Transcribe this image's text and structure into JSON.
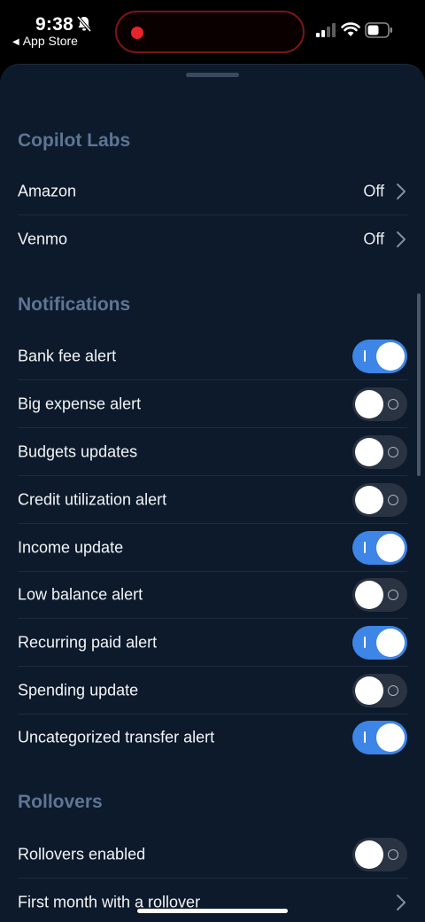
{
  "status_bar": {
    "time": "9:38",
    "back_app": "App Store",
    "icons": [
      "bell-slash-icon",
      "signal-icon",
      "wifi-icon",
      "battery-icon"
    ],
    "recording_color": "#e8232b"
  },
  "sections": {
    "copilot_labs": {
      "title": "Copilot Labs",
      "items": [
        {
          "label": "Amazon",
          "value": "Off"
        },
        {
          "label": "Venmo",
          "value": "Off"
        }
      ]
    },
    "notifications": {
      "title": "Notifications",
      "items": [
        {
          "label": "Bank fee alert",
          "enabled": true
        },
        {
          "label": "Big expense alert",
          "enabled": false
        },
        {
          "label": "Budgets updates",
          "enabled": false
        },
        {
          "label": "Credit utilization alert",
          "enabled": false
        },
        {
          "label": "Income update",
          "enabled": true
        },
        {
          "label": "Low balance alert",
          "enabled": false
        },
        {
          "label": "Recurring paid alert",
          "enabled": true
        },
        {
          "label": "Spending update",
          "enabled": false
        },
        {
          "label": "Uncategorized transfer alert",
          "enabled": true
        }
      ]
    },
    "rollovers": {
      "title": "Rollovers",
      "items": [
        {
          "label": "Rollovers enabled",
          "enabled": false
        },
        {
          "label": "First month with a rollover"
        }
      ]
    }
  },
  "colors": {
    "background": "#0c1a2b",
    "section_title": "#5e7594",
    "toggle_on": "#3d85e6",
    "toggle_off": "#2a3341"
  }
}
